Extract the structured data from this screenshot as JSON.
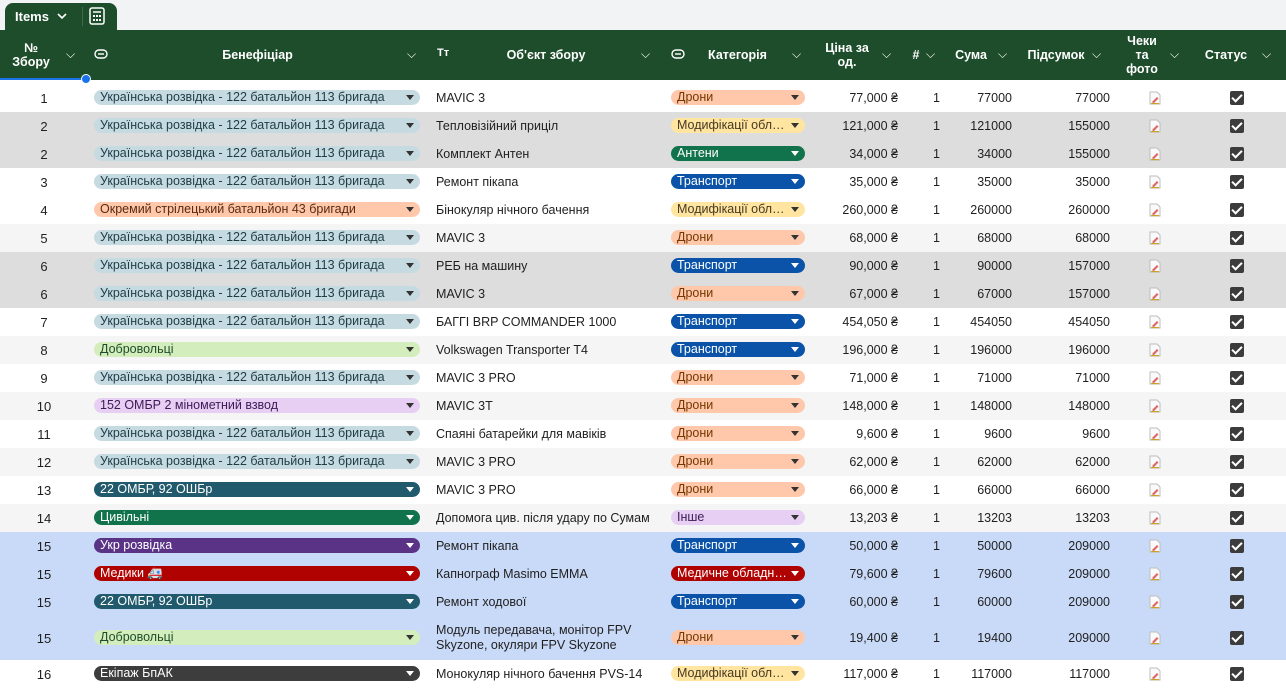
{
  "tab": {
    "label": "Items"
  },
  "headers": {
    "n": "№ Збору",
    "ben": "Бенефіціар",
    "tt": "Тт",
    "obj": "Об'єкт збору",
    "cat": "Категорія",
    "price": "Ціна за од.",
    "hash": "#",
    "sum": "Сума",
    "total": "Підсумок",
    "receipts": "Чеки та фото",
    "status": "Статус"
  },
  "colors": {
    "header": "#1e4d2b",
    "group_grey": "#dddddd",
    "group_blue": "#c9daf8",
    "alt": "#f5f5f5"
  },
  "rows": [
    {
      "n": "1",
      "ben": "Українська розвідка - 122 батальйон 113 бригада",
      "benStyle": "lblue",
      "obj": "MAVIC 3",
      "cat": "Дрони",
      "catStyle": "peach",
      "price": "77,000 ₴",
      "qty": "1",
      "sum": "77000",
      "total": "77000",
      "bg": "white",
      "h": 28
    },
    {
      "n": "2",
      "ben": "Українська розвідка - 122 батальйон 113 бригада",
      "benStyle": "lblue",
      "obj": "Тепловізійний приціл",
      "cat": "Модифікації обл…",
      "catStyle": "yellow",
      "price": "121,000 ₴",
      "qty": "1",
      "sum": "121000",
      "total": "155000",
      "bg": "grey",
      "h": 28
    },
    {
      "n": "2",
      "ben": "Українська розвідка - 122 батальйон 113 бригада",
      "benStyle": "lblue",
      "obj": "Комплект Антен",
      "cat": "Антени",
      "catStyle": "green",
      "price": "34,000 ₴",
      "qty": "1",
      "sum": "34000",
      "total": "155000",
      "bg": "grey",
      "h": 28
    },
    {
      "n": "3",
      "ben": "Українська розвідка - 122 батальйон 113 бригада",
      "benStyle": "lblue",
      "obj": "Ремонт пікапа",
      "cat": "Транспорт",
      "catStyle": "blue",
      "price": "35,000 ₴",
      "qty": "1",
      "sum": "35000",
      "total": "35000",
      "bg": "white",
      "h": 28
    },
    {
      "n": "4",
      "ben": "Окремий стрілецький батальйон 43 бригади",
      "benStyle": "orange",
      "obj": "Бінокуляр нічного бачення",
      "cat": "Модифікації обл…",
      "catStyle": "yellow",
      "price": "260,000 ₴",
      "qty": "1",
      "sum": "260000",
      "total": "260000",
      "bg": "white",
      "h": 28
    },
    {
      "n": "5",
      "ben": "Українська розвідка - 122 батальйон 113 бригада",
      "benStyle": "lblue",
      "obj": "MAVIC 3",
      "cat": "Дрони",
      "catStyle": "peach",
      "price": "68,000 ₴",
      "qty": "1",
      "sum": "68000",
      "total": "68000",
      "bg": "alt",
      "h": 28
    },
    {
      "n": "6",
      "ben": "Українська розвідка - 122 батальйон 113 бригада",
      "benStyle": "lblue",
      "obj": "РЕБ на машину",
      "cat": "Транспорт",
      "catStyle": "blue",
      "price": "90,000 ₴",
      "qty": "1",
      "sum": "90000",
      "total": "157000",
      "bg": "grey",
      "h": 28
    },
    {
      "n": "6",
      "ben": "Українська розвідка - 122 батальйон 113 бригада",
      "benStyle": "lblue",
      "obj": "MAVIC 3",
      "cat": "Дрони",
      "catStyle": "peach",
      "price": "67,000 ₴",
      "qty": "1",
      "sum": "67000",
      "total": "157000",
      "bg": "grey",
      "h": 28
    },
    {
      "n": "7",
      "ben": "Українська розвідка - 122 батальйон 113 бригада",
      "benStyle": "lblue",
      "obj": "БАГГІ BRP COMMANDER 1000",
      "cat": "Транспорт",
      "catStyle": "blue",
      "price": "454,050 ₴",
      "qty": "1",
      "sum": "454050",
      "total": "454050",
      "bg": "white",
      "h": 28
    },
    {
      "n": "8",
      "ben": "Добровольці",
      "benStyle": "lgreen",
      "obj": "Volkswagen Transporter T4",
      "cat": "Транспорт",
      "catStyle": "blue",
      "price": "196,000 ₴",
      "qty": "1",
      "sum": "196000",
      "total": "196000",
      "bg": "alt",
      "h": 28
    },
    {
      "n": "9",
      "ben": "Українська розвідка - 122 батальйон 113 бригада",
      "benStyle": "lblue",
      "obj": "MAVIC 3 PRO",
      "cat": "Дрони",
      "catStyle": "peach",
      "price": "71,000 ₴",
      "qty": "1",
      "sum": "71000",
      "total": "71000",
      "bg": "white",
      "h": 28
    },
    {
      "n": "10",
      "ben": "152 ОМБР 2 мінометний взвод",
      "benStyle": "lilac",
      "obj": "MAVIC 3T",
      "cat": "Дрони",
      "catStyle": "peach",
      "price": "148,000 ₴",
      "qty": "1",
      "sum": "148000",
      "total": "148000",
      "bg": "alt",
      "h": 28
    },
    {
      "n": "11",
      "ben": "Українська розвідка - 122 батальйон 113 бригада",
      "benStyle": "lblue",
      "obj": "Спаяні батарейки для мавіків",
      "cat": "Дрони",
      "catStyle": "peach",
      "price": "9,600 ₴",
      "qty": "1",
      "sum": "9600",
      "total": "9600",
      "bg": "white",
      "h": 28
    },
    {
      "n": "12",
      "ben": "Українська розвідка - 122 батальйон 113 бригада",
      "benStyle": "lblue",
      "obj": "MAVIC 3 PRO",
      "cat": "Дрони",
      "catStyle": "peach",
      "price": "62,000 ₴",
      "qty": "1",
      "sum": "62000",
      "total": "62000",
      "bg": "alt",
      "h": 28
    },
    {
      "n": "13",
      "ben": "22 ОМБР, 92 ОШБр",
      "benStyle": "teal",
      "obj": "MAVIC 3 PRO",
      "cat": "Дрони",
      "catStyle": "peach",
      "price": "66,000 ₴",
      "qty": "1",
      "sum": "66000",
      "total": "66000",
      "bg": "white",
      "h": 28
    },
    {
      "n": "14",
      "ben": "Цивільні",
      "benStyle": "green",
      "obj": "Допомога цив. після удару по Сумам",
      "cat": "Інше",
      "catStyle": "lilac",
      "price": "13,203 ₴",
      "qty": "1",
      "sum": "13203",
      "total": "13203",
      "bg": "alt",
      "h": 28
    },
    {
      "n": "15",
      "ben": "Укр розвідка",
      "benStyle": "purple",
      "obj": "Ремонт пікапа",
      "cat": "Транспорт",
      "catStyle": "blue",
      "price": "50,000 ₴",
      "qty": "1",
      "sum": "50000",
      "total": "209000",
      "bg": "blue",
      "h": 28
    },
    {
      "n": "15",
      "ben": "Медики 🚑",
      "benStyle": "red",
      "obj": "Капнограф Masimo EMMA",
      "cat": "Медичне обладн…",
      "catStyle": "red",
      "price": "79,600 ₴",
      "qty": "1",
      "sum": "79600",
      "total": "209000",
      "bg": "blue",
      "h": 28
    },
    {
      "n": "15",
      "ben": "22 ОМБР, 92 ОШБр",
      "benStyle": "teal",
      "obj": "Ремонт ходової",
      "cat": "Транспорт",
      "catStyle": "blue",
      "price": "60,000 ₴",
      "qty": "1",
      "sum": "60000",
      "total": "209000",
      "bg": "blue",
      "h": 28
    },
    {
      "n": "15",
      "ben": "Добровольці",
      "benStyle": "lgreen",
      "obj": "Модуль передавача, монітор FPV Skyzone, окуляри FPV Skyzone",
      "cat": "Дрони",
      "catStyle": "peach",
      "price": "19,400 ₴",
      "qty": "1",
      "sum": "19400",
      "total": "209000",
      "bg": "blue",
      "h": 44
    },
    {
      "n": "16",
      "ben": "Екіпаж БпАК",
      "benStyle": "dark",
      "obj": "Монокуляр нічного бачення PVS-14",
      "cat": "Модифікації обл…",
      "catStyle": "yellow",
      "price": "117,000 ₴",
      "qty": "1",
      "sum": "117000",
      "total": "117000",
      "bg": "white",
      "h": 28
    }
  ]
}
